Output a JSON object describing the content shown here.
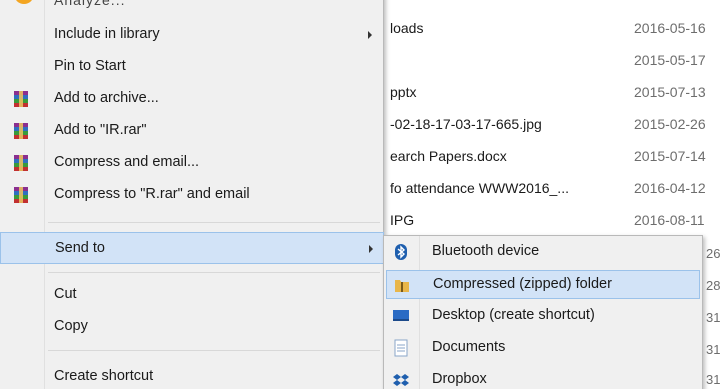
{
  "context_menu": {
    "top_partial_label": "Analyze...",
    "items": [
      {
        "label": "Include in library",
        "has_submenu": true
      },
      {
        "label": "Pin to Start"
      },
      {
        "label": "Add to archive..."
      },
      {
        "label": "Add to \"IR.rar\""
      },
      {
        "label": "Compress and email..."
      },
      {
        "label": "Compress to \"R.rar\" and email"
      },
      {
        "label": "Send to",
        "has_submenu": true
      },
      {
        "label": "Cut"
      },
      {
        "label": "Copy"
      },
      {
        "label": "Create shortcut"
      }
    ]
  },
  "send_to_submenu": {
    "items": [
      {
        "label": "Bluetooth device",
        "icon": "bluetooth-icon"
      },
      {
        "label": "Compressed (zipped) folder",
        "icon": "zip-folder-icon"
      },
      {
        "label": "Desktop (create shortcut)",
        "icon": "desktop-icon"
      },
      {
        "label": "Documents",
        "icon": "documents-icon"
      },
      {
        "label": "Dropbox",
        "icon": "dropbox-icon"
      }
    ]
  },
  "file_list": {
    "rows": [
      {
        "name": "loads",
        "date": "2016-05-16"
      },
      {
        "name": "",
        "date": "2015-05-17"
      },
      {
        "name": "pptx",
        "date": "2015-07-13"
      },
      {
        "name": "-02-18-17-03-17-665.jpg",
        "date": "2015-02-26"
      },
      {
        "name": "earch Papers.docx",
        "date": "2015-07-14"
      },
      {
        "name": "fo attendance WWW2016_...",
        "date": "2016-04-12"
      },
      {
        "name": "IPG",
        "date": "2016-08-11"
      }
    ],
    "partial_dates": [
      "26",
      "28",
      "31",
      "31",
      "31"
    ]
  },
  "colors": {
    "menu_bg": "#f0f0f0",
    "highlight_bg": "#d2e3f7",
    "highlight_border": "#9bc2ea"
  }
}
